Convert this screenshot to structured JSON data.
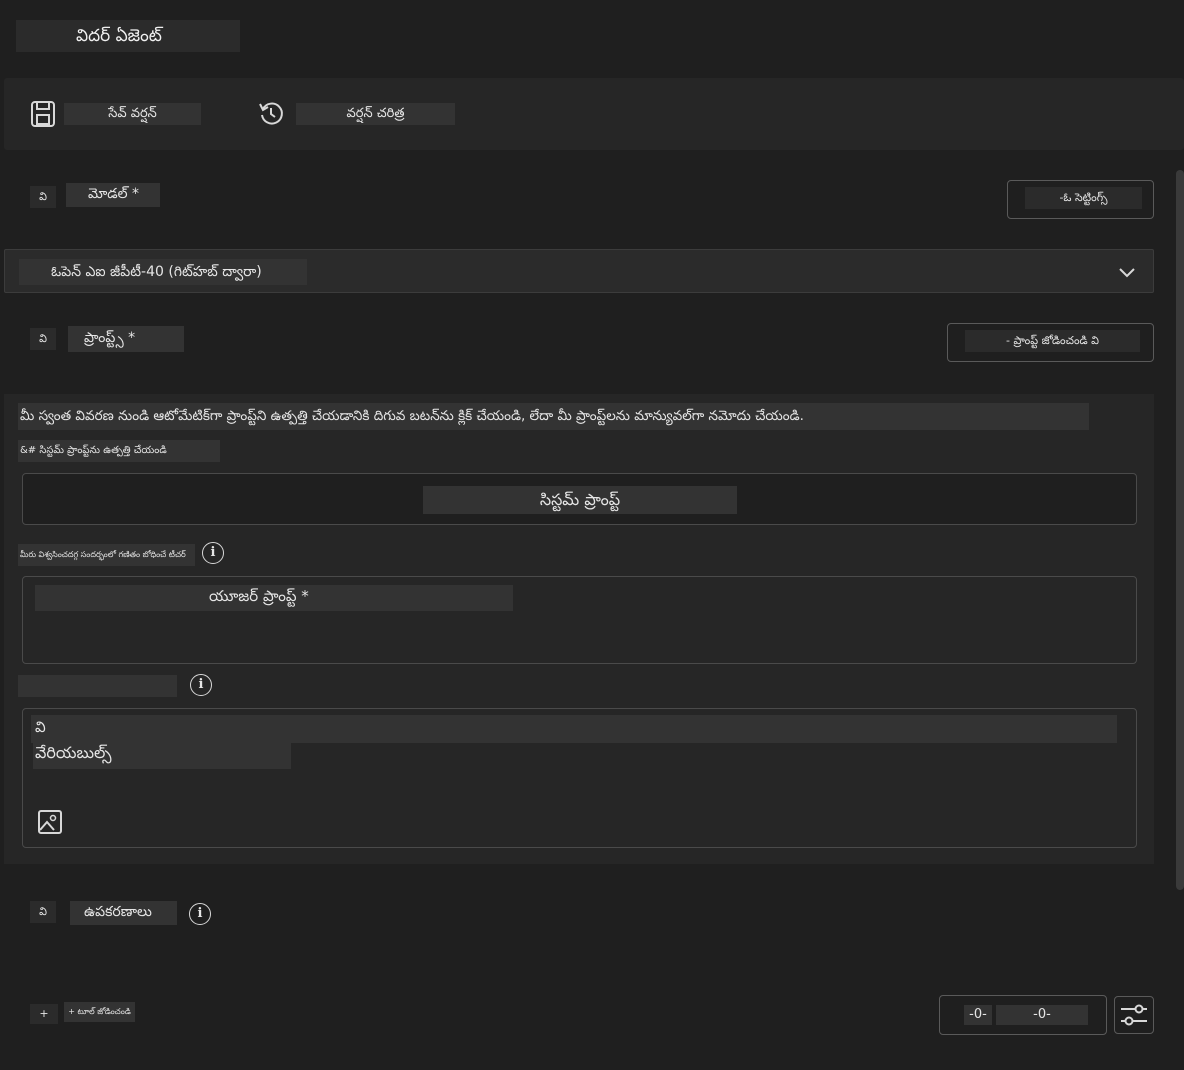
{
  "page_title": "విదర్ ఏజెంట్",
  "toolbar": {
    "save_label": "సేవ్ వర్షన్",
    "history_label": "వర్షన్ చరిత్ర"
  },
  "model": {
    "bullet": "వి",
    "label": "మోడల్ *",
    "settings_label": "-ఓ సెట్టింగ్స్",
    "selected": "ఓపెన్ ఎఐ జీపీటీ-40 (గిట్‌హబ్ ద్వారా)"
  },
  "prompts": {
    "bullet": "వి",
    "label": "ప్రాంప్ట్స్ *",
    "add_label": "- ప్రాంప్ట్ జోడించండి వి",
    "description": "మీ స్వంత వివరణ నుండి ఆటోమేటిక్‌గా ప్రాంప్ట్‌ని ఉత్పత్తి చేయడానికి దిగువ బటన్‌ను క్లిక్ చేయండి, లేదా మీ ప్రాంప్ట్‌లను మాన్యువల్‌గా నమోదు చేయండి.",
    "generate_label": "&# సిస్టమ్ ప్రాంప్ట్‌ను ఉత్పత్తి చేయండి",
    "system_prompt": "సిస్టమ్ ప్రాంప్ట్",
    "user_hint": "మీరు విశ్వసించదగ్గ సందర్భంలో గణితం బోధించే టీచర్",
    "user_prompt": "యూజర్ ప్రాంప్ట్ *",
    "var_hint": "",
    "var_bullet": "వి",
    "variables": "వేరియబుల్స్"
  },
  "tools": {
    "bullet": "వి",
    "label": "ఉపకరణాలు",
    "add_bullet": "+",
    "add_label": "+ టూల్ జోడించండి",
    "counter_a": "-0-",
    "counter_b": "-0-"
  },
  "icons": {
    "save": "save-icon",
    "history": "history-icon",
    "chevron": "chevron-down-icon",
    "info": "info-icon",
    "image": "image-icon",
    "sliders": "sliders-icon"
  }
}
